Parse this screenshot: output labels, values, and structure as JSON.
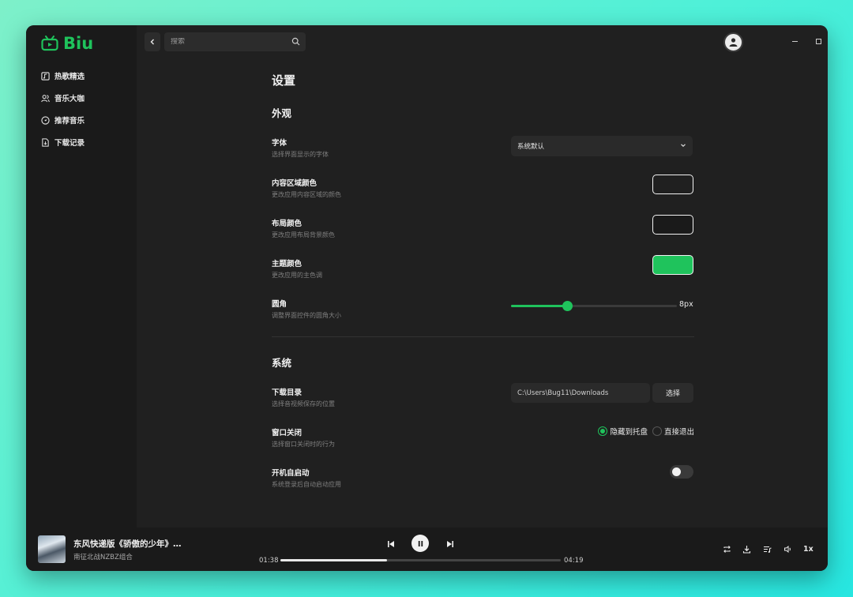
{
  "app": {
    "name": "Biu",
    "accent": "#1fc35c"
  },
  "sidebar": {
    "items": [
      {
        "label": "热歌精选",
        "icon": "music-note-box-icon"
      },
      {
        "label": "音乐大咖",
        "icon": "users-icon"
      },
      {
        "label": "推荐音乐",
        "icon": "compass-icon"
      },
      {
        "label": "下载记录",
        "icon": "file-download-icon"
      }
    ]
  },
  "topbar": {
    "search_placeholder": "搜索"
  },
  "settings": {
    "title": "设置",
    "appearance": {
      "title": "外观",
      "font": {
        "label": "字体",
        "desc": "选择界面显示的字体",
        "value": "系统默认"
      },
      "content_color": {
        "label": "内容区域颜色",
        "desc": "更改应用内容区域的颜色",
        "value": "#202020"
      },
      "layout_color": {
        "label": "布局颜色",
        "desc": "更改应用布局背景颜色",
        "value": "#1a1a1a"
      },
      "theme_color": {
        "label": "主题颜色",
        "desc": "更改应用的主色调",
        "value": "#1fc35c"
      },
      "radius": {
        "label": "圆角",
        "desc": "调整界面控件的圆角大小",
        "value_text": "8px",
        "fraction": 0.34
      }
    },
    "system": {
      "title": "系统",
      "download_dir": {
        "label": "下载目录",
        "desc": "选择音视频保存的位置",
        "value": "C:\\Users\\Bug11\\Downloads",
        "button": "选择"
      },
      "window_close": {
        "label": "窗口关闭",
        "desc": "选择窗口关闭时的行为",
        "options": [
          "隐藏到托盘",
          "直接退出"
        ],
        "selected": "隐藏到托盘"
      },
      "autostart": {
        "label": "开机自启动",
        "desc": "系统登录后自动启动应用",
        "enabled": false
      }
    }
  },
  "player": {
    "title": "东风快递版《骄傲的少年》…",
    "artist": "南征北战NZBZ组合",
    "current_time": "01:38",
    "total_time": "04:19",
    "progress": 0.38,
    "speed": "1x"
  }
}
